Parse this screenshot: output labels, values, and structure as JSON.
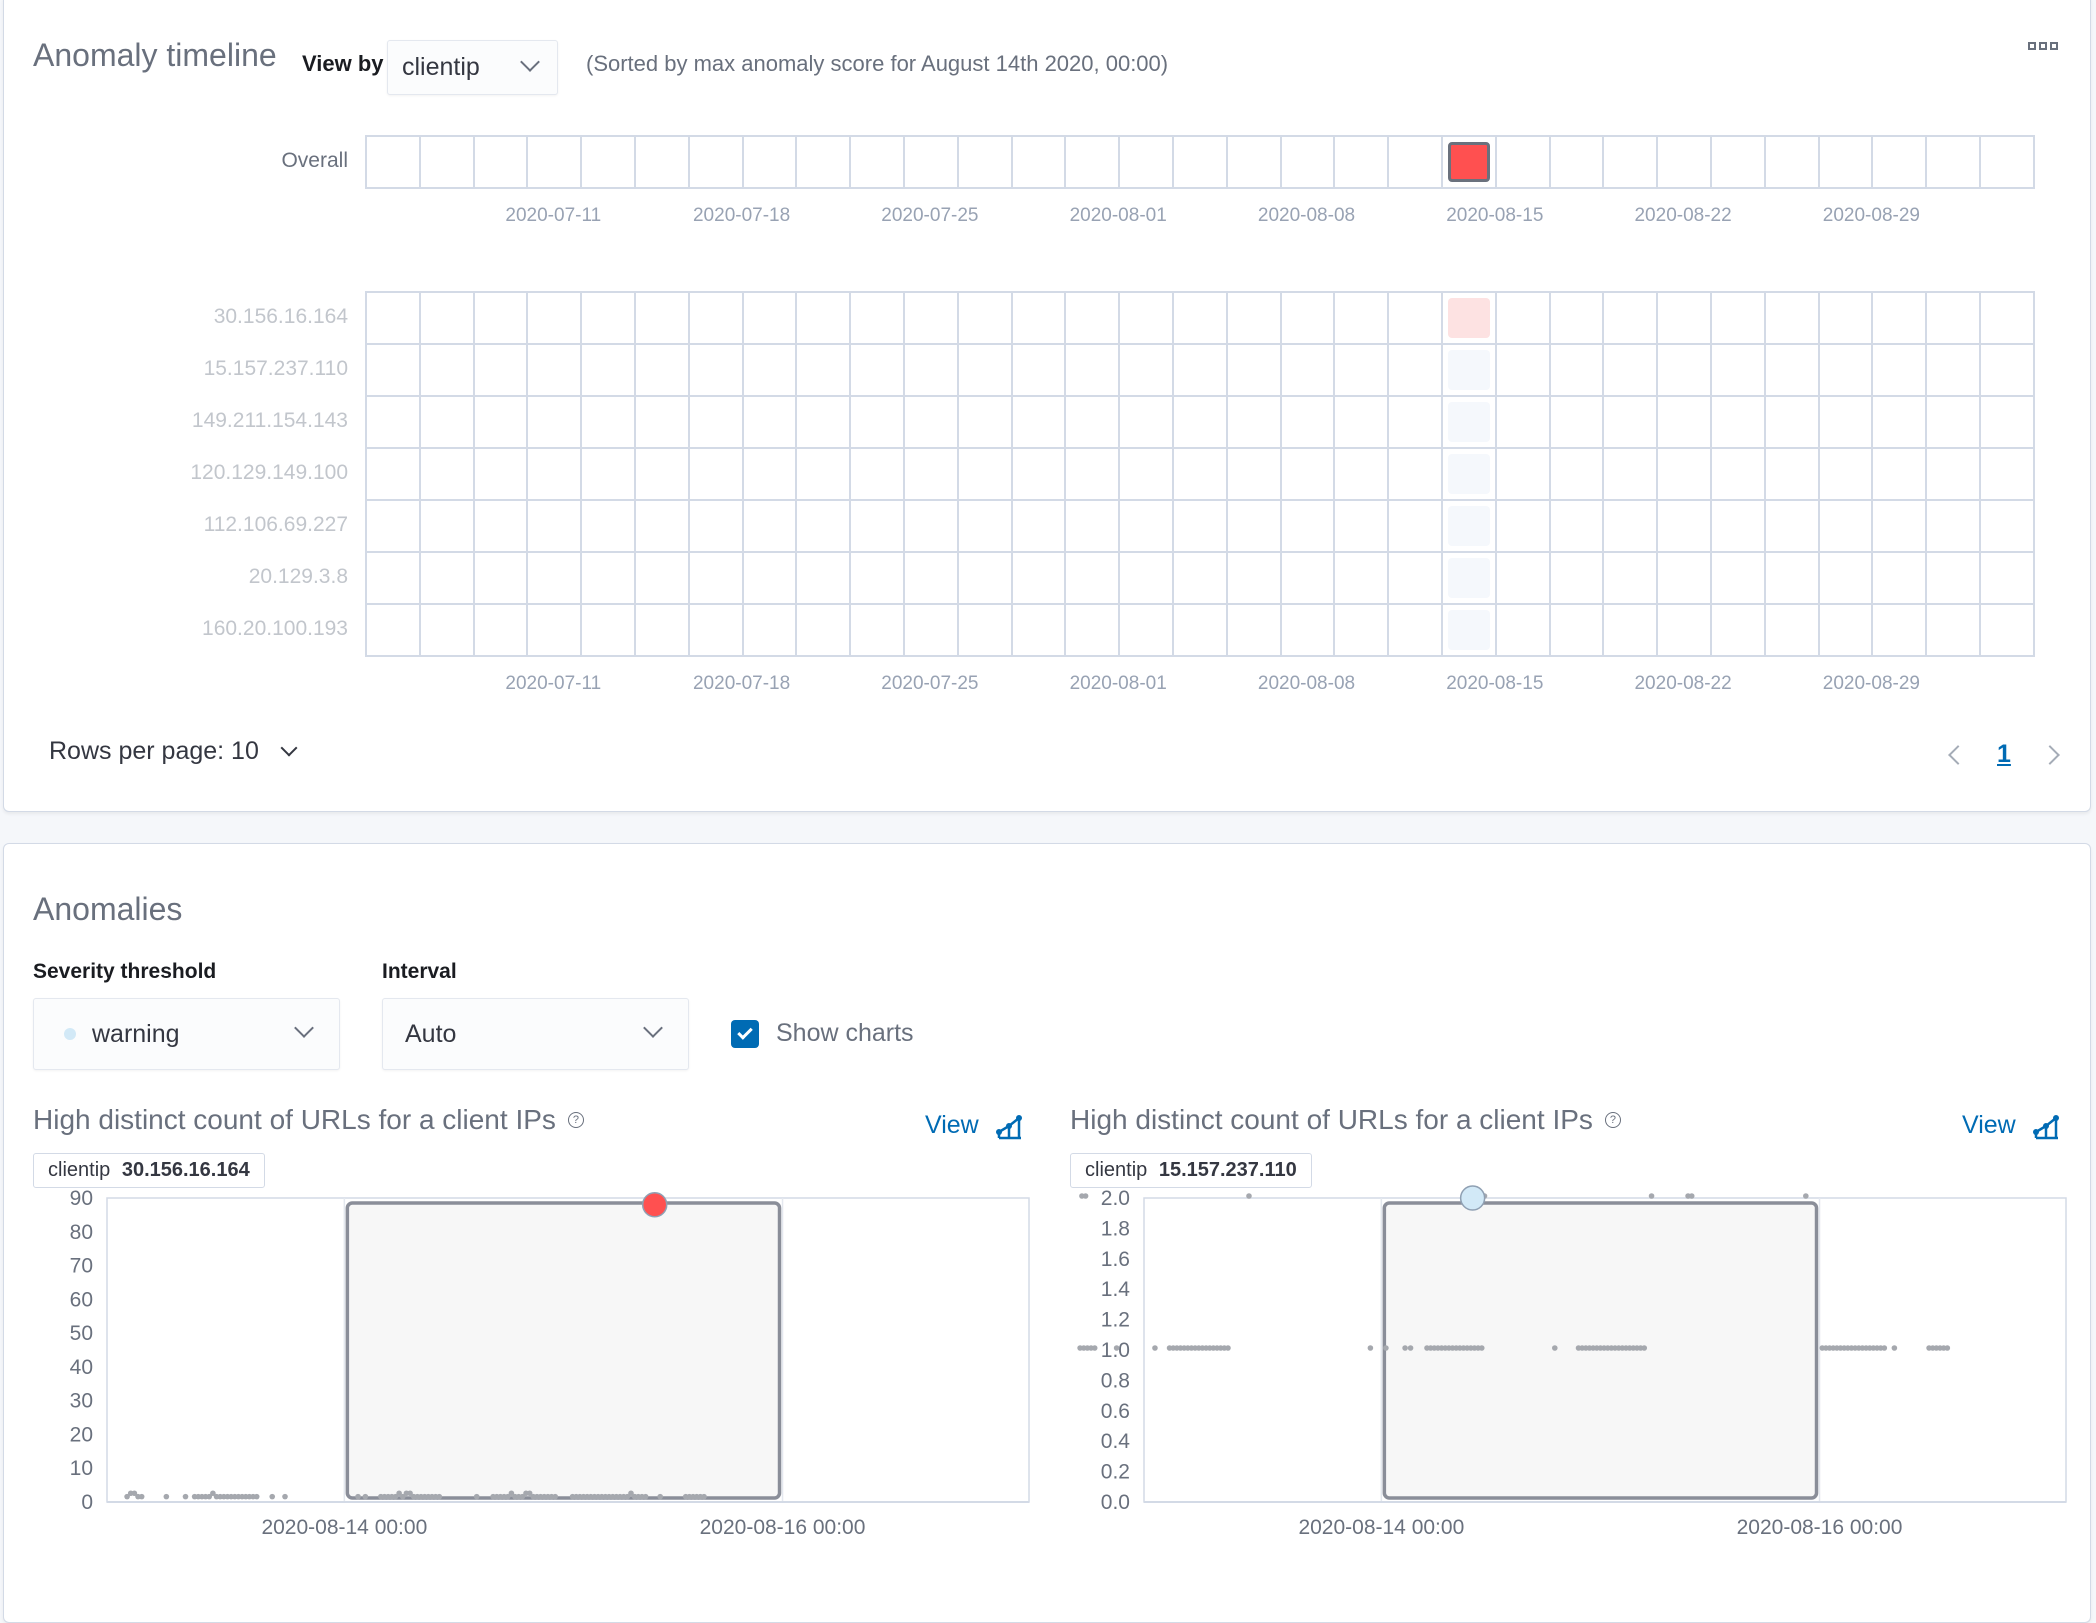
{
  "timeline": {
    "title": "Anomaly timeline",
    "view_by_label": "View by",
    "view_by_value": "clientip",
    "sorted_note": "(Sorted by max anomaly score for August 14th 2020, 00:00)",
    "more_icon": "boxes-horizontal-icon",
    "overall_label": "Overall",
    "num_columns": 31,
    "anomaly_column": 20,
    "overall_cells": [
      {
        "column": 20,
        "score_color": "#ff5050",
        "selected": true
      }
    ],
    "lanes": [
      {
        "label": "30.156.16.164",
        "cells": [
          {
            "column": 20,
            "score_color": "#fde2e2"
          }
        ]
      },
      {
        "label": "15.157.237.110",
        "cells": [
          {
            "column": 20,
            "score_color": "#f5f8fc"
          }
        ]
      },
      {
        "label": "149.211.154.143",
        "cells": [
          {
            "column": 20,
            "score_color": "#f5f8fc"
          }
        ]
      },
      {
        "label": "120.129.149.100",
        "cells": [
          {
            "column": 20,
            "score_color": "#f5f8fc"
          }
        ]
      },
      {
        "label": "112.106.69.227",
        "cells": [
          {
            "column": 20,
            "score_color": "#f5f8fc"
          }
        ]
      },
      {
        "label": "20.129.3.8",
        "cells": [
          {
            "column": 20,
            "score_color": "#f5f8fc"
          }
        ]
      },
      {
        "label": "160.20.100.193",
        "cells": [
          {
            "column": 20,
            "score_color": "#f5f8fc"
          }
        ]
      }
    ],
    "x_ticks": [
      {
        "label": "2020-07-11",
        "column": 3.5
      },
      {
        "label": "2020-07-18",
        "column": 7
      },
      {
        "label": "2020-07-25",
        "column": 10.5
      },
      {
        "label": "2020-08-01",
        "column": 14
      },
      {
        "label": "2020-08-08",
        "column": 17.5
      },
      {
        "label": "2020-08-15",
        "column": 21
      },
      {
        "label": "2020-08-22",
        "column": 24.5
      },
      {
        "label": "2020-08-29",
        "column": 28
      }
    ],
    "rows_per_page_label": "Rows per page: 10",
    "current_page": "1"
  },
  "anomalies": {
    "title": "Anomalies",
    "severity_label": "Severity threshold",
    "severity_value": "warning",
    "severity_color": "#d2e9f7",
    "interval_label": "Interval",
    "interval_value": "Auto",
    "show_charts_label": "Show charts",
    "show_charts_checked": true,
    "charts": [
      {
        "title": "High distinct count of URLs for a client IPs",
        "view_label": "View",
        "entity_field": "clientip",
        "entity_value": "30.156.16.164"
      },
      {
        "title": "High distinct count of URLs for a client IPs",
        "view_label": "View",
        "entity_field": "clientip",
        "entity_value": "15.157.237.110"
      }
    ]
  },
  "chart_data": [
    {
      "type": "scatter",
      "title": "High distinct count of URLs for a client IPs",
      "entity": "clientip 30.156.16.164",
      "xlabel": "",
      "ylabel": "",
      "ylim": [
        0,
        90
      ],
      "y_ticks": [
        "0",
        "10",
        "20",
        "30",
        "40",
        "50",
        "60",
        "70",
        "80",
        "90"
      ],
      "x_range_hours": [
        -24,
        48
      ],
      "x_ticks": [
        {
          "label": "2020-08-14 00:00",
          "hour": 0
        },
        {
          "label": "2020-08-16 00:00",
          "hour": 48
        }
      ],
      "x_ticks_hours": [
        0,
        48
      ],
      "highlight_range_hours": [
        0,
        48
      ],
      "anomaly": {
        "hour": 34,
        "value": 88,
        "color": "#ff5050"
      },
      "series_value_default": 1,
      "series_points_note": "hourly values mostly 1-2 across range",
      "x_span_hours": [
        -24,
        72
      ],
      "points": [
        [
          -23.8,
          1
        ],
        [
          -23.4,
          2
        ],
        [
          -23,
          2
        ],
        [
          -22.6,
          1
        ],
        [
          -22.2,
          1
        ],
        [
          -19.5,
          1
        ],
        [
          -17.4,
          1
        ],
        [
          -16.4,
          1
        ],
        [
          -16,
          1
        ],
        [
          -15.6,
          1
        ],
        [
          -15.2,
          1
        ],
        [
          -14.8,
          1
        ],
        [
          -14.4,
          2
        ],
        [
          -14,
          1
        ],
        [
          -13.6,
          1
        ],
        [
          -13.2,
          1
        ],
        [
          -12.8,
          1
        ],
        [
          -12.4,
          1
        ],
        [
          -12,
          1
        ],
        [
          -11.6,
          1
        ],
        [
          -11.2,
          1
        ],
        [
          -10.8,
          1
        ],
        [
          -10.4,
          1
        ],
        [
          -10,
          1
        ],
        [
          -9.6,
          1
        ],
        [
          -7.9,
          1
        ],
        [
          -6.5,
          1
        ],
        [
          1.5,
          1
        ],
        [
          2.3,
          1
        ],
        [
          4,
          1
        ],
        [
          4.4,
          1
        ],
        [
          4.8,
          1
        ],
        [
          5.2,
          1
        ],
        [
          5.6,
          1
        ],
        [
          6,
          2
        ],
        [
          6.4,
          1
        ],
        [
          6.8,
          2
        ],
        [
          7.2,
          2
        ],
        [
          7.6,
          1
        ],
        [
          8,
          1
        ],
        [
          8.4,
          1
        ],
        [
          8.8,
          1
        ],
        [
          9.2,
          1
        ],
        [
          9.6,
          1
        ],
        [
          10,
          1
        ],
        [
          10.4,
          1
        ],
        [
          14.5,
          1
        ],
        [
          16.3,
          1
        ],
        [
          16.7,
          1
        ],
        [
          17.1,
          1
        ],
        [
          17.5,
          1
        ],
        [
          17.9,
          1
        ],
        [
          18.3,
          2
        ],
        [
          18.7,
          1
        ],
        [
          19.1,
          1
        ],
        [
          19.5,
          1
        ],
        [
          19.9,
          2
        ],
        [
          20.3,
          2
        ],
        [
          20.7,
          1
        ],
        [
          21.1,
          1
        ],
        [
          21.5,
          1
        ],
        [
          21.9,
          1
        ],
        [
          22.3,
          1
        ],
        [
          22.7,
          1
        ],
        [
          23.1,
          1
        ],
        [
          25,
          1
        ],
        [
          25.4,
          1
        ],
        [
          25.8,
          1
        ],
        [
          26.2,
          1
        ],
        [
          26.6,
          1
        ],
        [
          27,
          1
        ],
        [
          27.4,
          1
        ],
        [
          27.8,
          1
        ],
        [
          28.2,
          1
        ],
        [
          28.6,
          1
        ],
        [
          29,
          1
        ],
        [
          29.4,
          1
        ],
        [
          29.8,
          1
        ],
        [
          30.2,
          1
        ],
        [
          30.6,
          1
        ],
        [
          31,
          1
        ],
        [
          31.4,
          2
        ],
        [
          31.8,
          1
        ],
        [
          32.2,
          1
        ],
        [
          32.6,
          1
        ],
        [
          33,
          1
        ],
        [
          34.6,
          1
        ],
        [
          37.4,
          1
        ],
        [
          37.8,
          1
        ],
        [
          38.2,
          1
        ],
        [
          38.6,
          1
        ],
        [
          39,
          1
        ],
        [
          39.4,
          1
        ]
      ]
    },
    {
      "type": "scatter",
      "title": "High distinct count of URLs for a client IPs",
      "entity": "clientip 15.157.237.110",
      "xlabel": "",
      "ylabel": "",
      "ylim": [
        0,
        2
      ],
      "y_ticks": [
        "0.0",
        "0.2",
        "0.4",
        "0.6",
        "0.8",
        "1.0",
        "1.2",
        "1.4",
        "1.6",
        "1.8",
        "2.0"
      ],
      "x_ticks": [
        {
          "label": "2020-08-14 00:00",
          "hour": 0
        },
        {
          "label": "2020-08-16 00:00",
          "hour": 48
        }
      ],
      "highlight_range_hours": [
        0,
        48
      ],
      "anomaly": {
        "hour": 10,
        "value": 2,
        "color": "#d2e9f7"
      },
      "points": [
        [
          -32.8,
          2
        ],
        [
          -32.4,
          2
        ],
        [
          -14.5,
          2
        ],
        [
          10.9,
          2
        ],
        [
          11.3,
          2
        ],
        [
          29.6,
          2
        ],
        [
          33.6,
          2
        ],
        [
          34,
          2
        ],
        [
          46.5,
          2
        ],
        [
          -33,
          1
        ],
        [
          -32.6,
          1
        ],
        [
          -32.2,
          1
        ],
        [
          -31.8,
          1
        ],
        [
          -31.4,
          1
        ],
        [
          -29,
          1
        ],
        [
          -24.8,
          1
        ],
        [
          -23.2,
          1
        ],
        [
          -22.8,
          1
        ],
        [
          -22.4,
          1
        ],
        [
          -22,
          1
        ],
        [
          -21.6,
          1
        ],
        [
          -21.2,
          1
        ],
        [
          -20.8,
          1
        ],
        [
          -20.4,
          1
        ],
        [
          -20,
          1
        ],
        [
          -19.6,
          1
        ],
        [
          -19.2,
          1
        ],
        [
          -18.8,
          1
        ],
        [
          -18.4,
          1
        ],
        [
          -18,
          1
        ],
        [
          -17.6,
          1
        ],
        [
          -17.2,
          1
        ],
        [
          -16.8,
          1
        ],
        [
          -1.2,
          1
        ],
        [
          0.5,
          1
        ],
        [
          2.6,
          1
        ],
        [
          3.2,
          1
        ],
        [
          5,
          1
        ],
        [
          5.4,
          1
        ],
        [
          5.8,
          1
        ],
        [
          6.2,
          1
        ],
        [
          6.6,
          1
        ],
        [
          7,
          1
        ],
        [
          7.4,
          1
        ],
        [
          7.8,
          1
        ],
        [
          8.2,
          1
        ],
        [
          8.6,
          1
        ],
        [
          9,
          1
        ],
        [
          9.4,
          1
        ],
        [
          9.8,
          1
        ],
        [
          10.2,
          1
        ],
        [
          10.6,
          1
        ],
        [
          11,
          1
        ],
        [
          19,
          1
        ],
        [
          21.6,
          1
        ],
        [
          22,
          1
        ],
        [
          22.4,
          1
        ],
        [
          22.8,
          1
        ],
        [
          23.2,
          1
        ],
        [
          23.6,
          1
        ],
        [
          24,
          1
        ],
        [
          24.4,
          1
        ],
        [
          24.8,
          1
        ],
        [
          25.2,
          1
        ],
        [
          25.6,
          1
        ],
        [
          26,
          1
        ],
        [
          26.4,
          1
        ],
        [
          26.8,
          1
        ],
        [
          27.2,
          1
        ],
        [
          27.6,
          1
        ],
        [
          28,
          1
        ],
        [
          28.4,
          1
        ],
        [
          28.8,
          1
        ],
        [
          48.3,
          1
        ],
        [
          48.7,
          1
        ],
        [
          49.1,
          1
        ],
        [
          49.5,
          1
        ],
        [
          49.9,
          1
        ],
        [
          50.3,
          1
        ],
        [
          50.7,
          1
        ],
        [
          51.1,
          1
        ],
        [
          51.5,
          1
        ],
        [
          51.9,
          1
        ],
        [
          52.3,
          1
        ],
        [
          52.7,
          1
        ],
        [
          53.1,
          1
        ],
        [
          53.5,
          1
        ],
        [
          53.9,
          1
        ],
        [
          54.3,
          1
        ],
        [
          54.7,
          1
        ],
        [
          55.1,
          1
        ],
        [
          56.2,
          1
        ],
        [
          60,
          1
        ],
        [
          60.4,
          1
        ],
        [
          60.8,
          1
        ],
        [
          61.2,
          1
        ],
        [
          61.6,
          1
        ],
        [
          62,
          1
        ]
      ]
    }
  ]
}
